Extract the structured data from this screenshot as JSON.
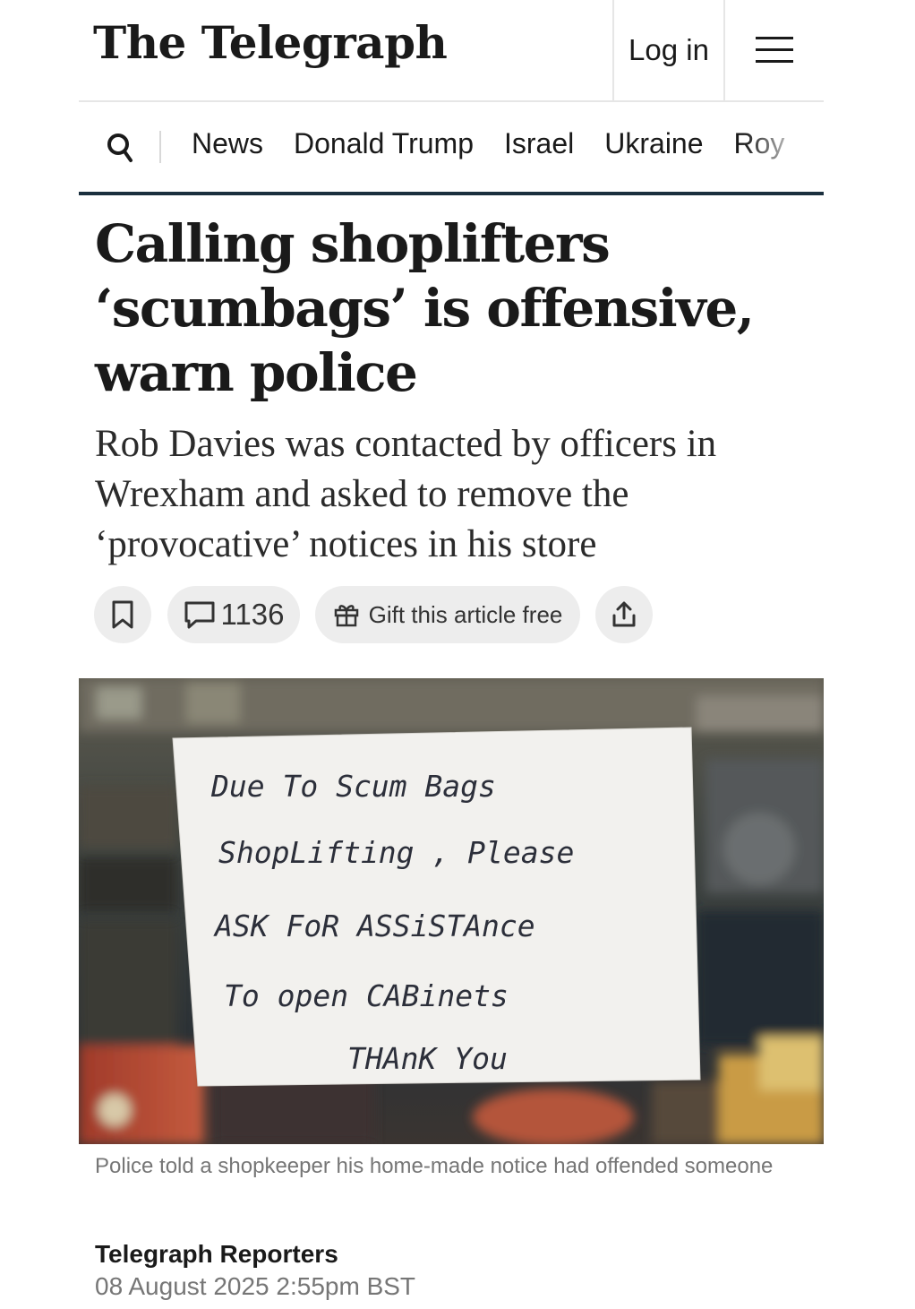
{
  "header": {
    "logo": "The Telegraph",
    "login_label": "Log in"
  },
  "nav": {
    "items": [
      "News",
      "Donald Trump",
      "Israel",
      "Ukraine",
      "Roy"
    ]
  },
  "article": {
    "headline": "Calling shoplifters ‘scumbags’ is offensive, warn police",
    "standfirst": "Rob Davies was contacted by officers in Wrexham and asked to remove the ‘provocative’ notices in his store",
    "actions": {
      "comment_count": "1136",
      "gift_label": "Gift this article free"
    },
    "image": {
      "note_lines": [
        "Due To Scum Bags",
        "ShopLifting , Please",
        "ASK FoR ASSiSTAnce",
        "To open CABinets",
        "THAnK You"
      ]
    },
    "caption": "Police told a shopkeeper his home-made notice had offended someone",
    "byline": "Telegraph Reporters",
    "date": "08 August 2025 2:55pm BST"
  }
}
